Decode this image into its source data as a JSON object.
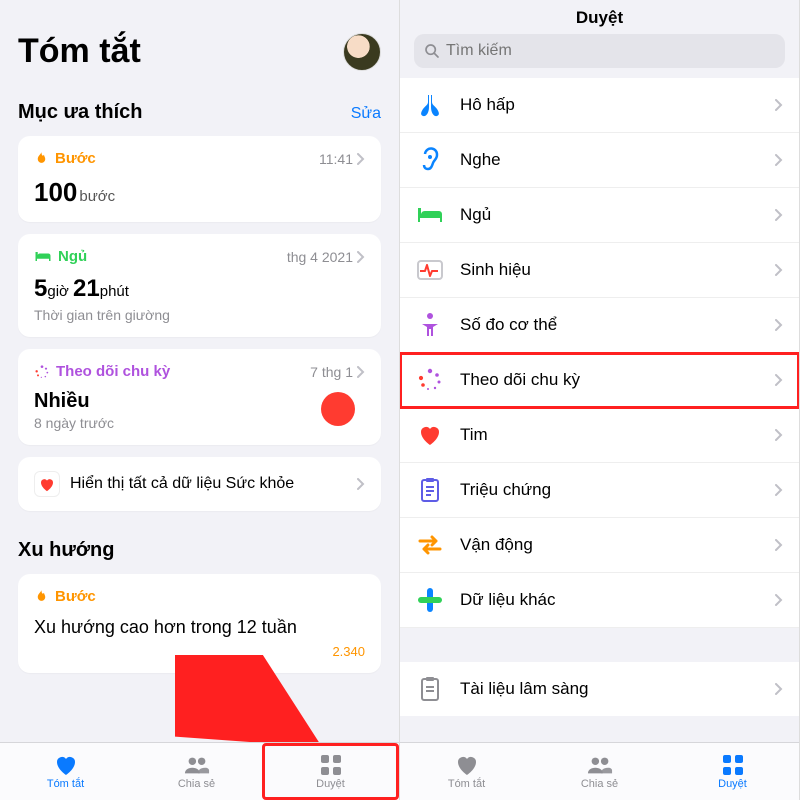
{
  "left": {
    "title": "Tóm tắt",
    "favorites": {
      "heading": "Mục ưa thích",
      "edit": "Sửa"
    },
    "steps": {
      "label": "Bước",
      "time": "11:41",
      "value": "100",
      "unit": "bước"
    },
    "sleep": {
      "label": "Ngủ",
      "time": "thg 4 2021",
      "hours": "5",
      "hours_unit": "giờ",
      "mins": "21",
      "mins_unit": "phút",
      "sub": "Thời gian trên giường"
    },
    "cycle": {
      "label": "Theo dõi chu kỳ",
      "time": "7 thg 1",
      "heavy": "Nhiều",
      "sub": "8 ngày trước"
    },
    "showall": "Hiển thị tất cả dữ liệu Sức khỏe",
    "trends": {
      "heading": "Xu hướng",
      "label": "Bước",
      "text": "Xu hướng cao hơn trong 12 tuần",
      "value": "2.340"
    },
    "tabs": {
      "summary": "Tóm tắt",
      "share": "Chia sẻ",
      "browse": "Duyệt"
    }
  },
  "right": {
    "title": "Duyệt",
    "search_placeholder": "Tìm kiếm",
    "rows": {
      "respiratory": "Hô hấp",
      "hearing": "Nghe",
      "sleep": "Ngủ",
      "vitals": "Sinh hiệu",
      "body": "Số đo cơ thể",
      "cycle": "Theo dõi chu kỳ",
      "heart": "Tim",
      "symptoms": "Triệu chứng",
      "mobility": "Vận động",
      "other": "Dữ liệu khác",
      "clinical": "Tài liệu lâm sàng"
    },
    "tabs": {
      "summary": "Tóm tắt",
      "share": "Chia sẻ",
      "browse": "Duyệt"
    }
  }
}
